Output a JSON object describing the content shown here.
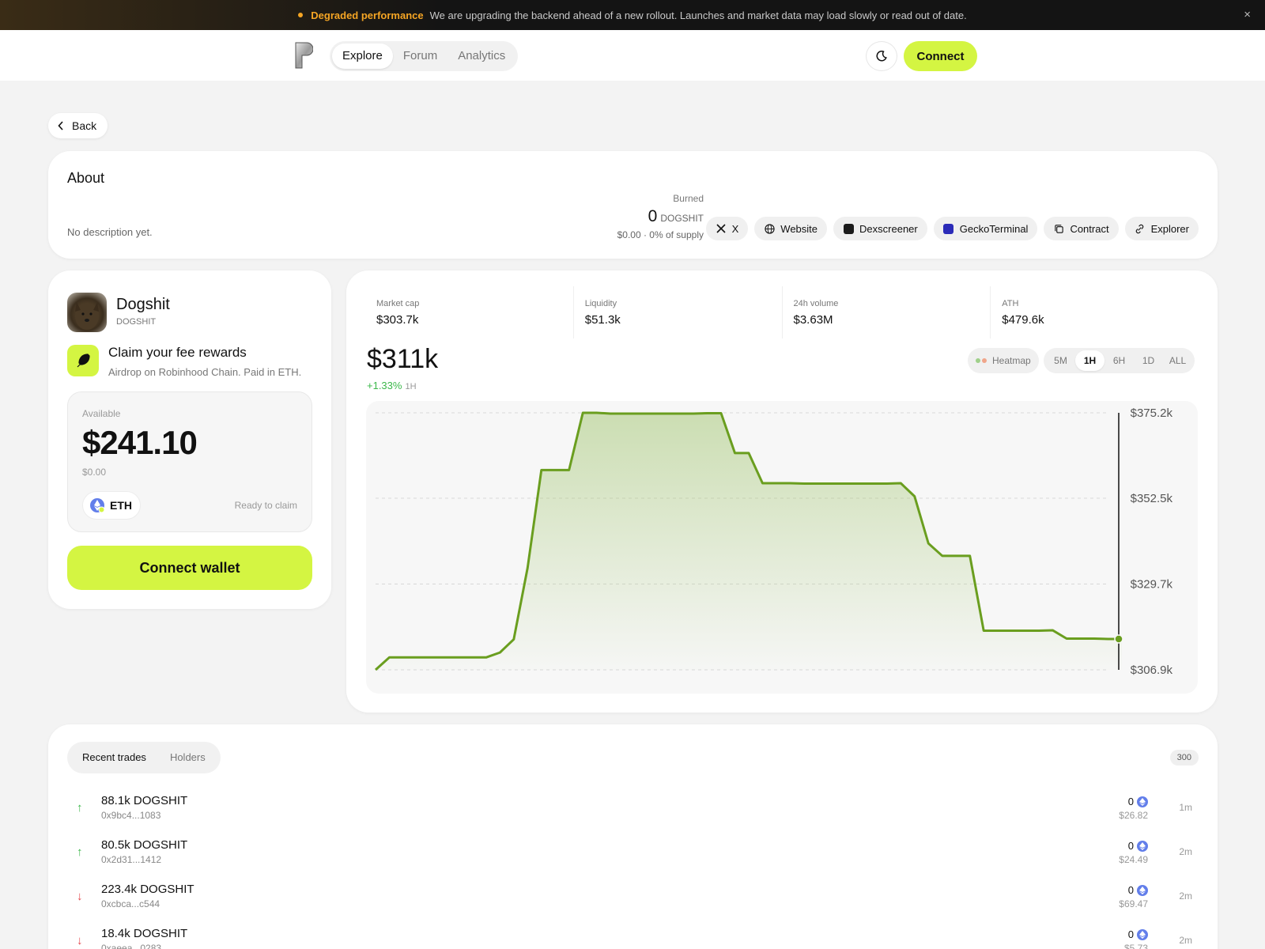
{
  "banner": {
    "title": "Degraded performance",
    "message": "We are upgrading the backend ahead of a new rollout. Launches and market data may load slowly or read out of date.",
    "close_icon": "×"
  },
  "nav": {
    "tabs": [
      "Explore",
      "Forum",
      "Analytics"
    ],
    "active": "Explore",
    "connect_label": "Connect"
  },
  "back_label": "Back",
  "about": {
    "title": "About",
    "description": "No description yet.",
    "burned_label": "Burned",
    "burned_amount": "0",
    "burned_unit": "DOGSHIT",
    "burned_sub": "$0.00 · 0% of supply",
    "links": [
      "X",
      "Website",
      "Dexscreener",
      "GeckoTerminal",
      "Contract",
      "Explorer"
    ]
  },
  "token": {
    "name": "Dogshit",
    "symbol": "DOGSHIT",
    "claim_title": "Claim your fee rewards",
    "claim_sub": "Airdrop on Robinhood Chain. Paid in ETH.",
    "available_label": "Available",
    "available_amount": "$241.10",
    "available_usd": "$0.00",
    "currency": "ETH",
    "status": "Ready to claim",
    "wallet_button": "Connect wallet"
  },
  "stats": [
    {
      "label": "Market cap",
      "value": "$303.7k"
    },
    {
      "label": "Liquidity",
      "value": "$51.3k"
    },
    {
      "label": "24h volume",
      "value": "$3.63M"
    },
    {
      "label": "ATH",
      "value": "$479.6k"
    }
  ],
  "price": {
    "value": "$311k",
    "change": "+1.33%",
    "timeframe": "1H"
  },
  "chart_controls": {
    "heatmap_label": "Heatmap",
    "timeframes": [
      "5M",
      "1H",
      "6H",
      "1D",
      "ALL"
    ],
    "active_timeframe": "1H"
  },
  "colors": {
    "accent": "#d4f542",
    "line": "#6a9e1f",
    "up": "#3bb84a",
    "down": "#e5484d"
  },
  "chart_data": {
    "type": "area",
    "title": "",
    "xlabel": "",
    "ylabel": "",
    "y_ticks": [
      "$375.2k",
      "$352.5k",
      "$329.7k",
      "$306.9k"
    ],
    "y_tick_values": [
      375.2,
      352.5,
      329.7,
      306.9
    ],
    "ylim": [
      306.9,
      375.2
    ],
    "grid": true,
    "series": [
      {
        "values": [
          306.9,
          310.2,
          310.2,
          310.2,
          310.2,
          310.2,
          310.2,
          310.2,
          310.2,
          311.5,
          315.0,
          334.0,
          360.0,
          360.0,
          360.0,
          375.2,
          375.2,
          375.0,
          375.0,
          375.0,
          375.0,
          375.0,
          375.0,
          375.0,
          375.1,
          375.1,
          364.5,
          364.5,
          356.5,
          356.5,
          356.5,
          356.4,
          356.4,
          356.4,
          356.4,
          356.4,
          356.4,
          356.4,
          356.5,
          353.0,
          340.5,
          337.2,
          337.2,
          337.2,
          317.3,
          317.3,
          317.3,
          317.3,
          317.3,
          317.4,
          315.2,
          315.2,
          315.2,
          315.1,
          315.1
        ]
      }
    ],
    "y_domain": [
      303.8,
      378.3
    ]
  },
  "trades": {
    "tabs": [
      "Recent trades",
      "Holders"
    ],
    "active": "Recent trades",
    "count": "300",
    "rows": [
      {
        "side": "buy",
        "amount": "88.1k DOGSHIT",
        "address": "0x9bc4...1083",
        "eth": "0",
        "usd": "$26.82",
        "time": "1m"
      },
      {
        "side": "buy",
        "amount": "80.5k DOGSHIT",
        "address": "0x2d31...1412",
        "eth": "0",
        "usd": "$24.49",
        "time": "2m"
      },
      {
        "side": "sell",
        "amount": "223.4k DOGSHIT",
        "address": "0xcbca...c544",
        "eth": "0",
        "usd": "$69.47",
        "time": "2m"
      },
      {
        "side": "sell",
        "amount": "18.4k DOGSHIT",
        "address": "0xaeea...0283",
        "eth": "0",
        "usd": "$5.73",
        "time": "2m"
      }
    ]
  }
}
